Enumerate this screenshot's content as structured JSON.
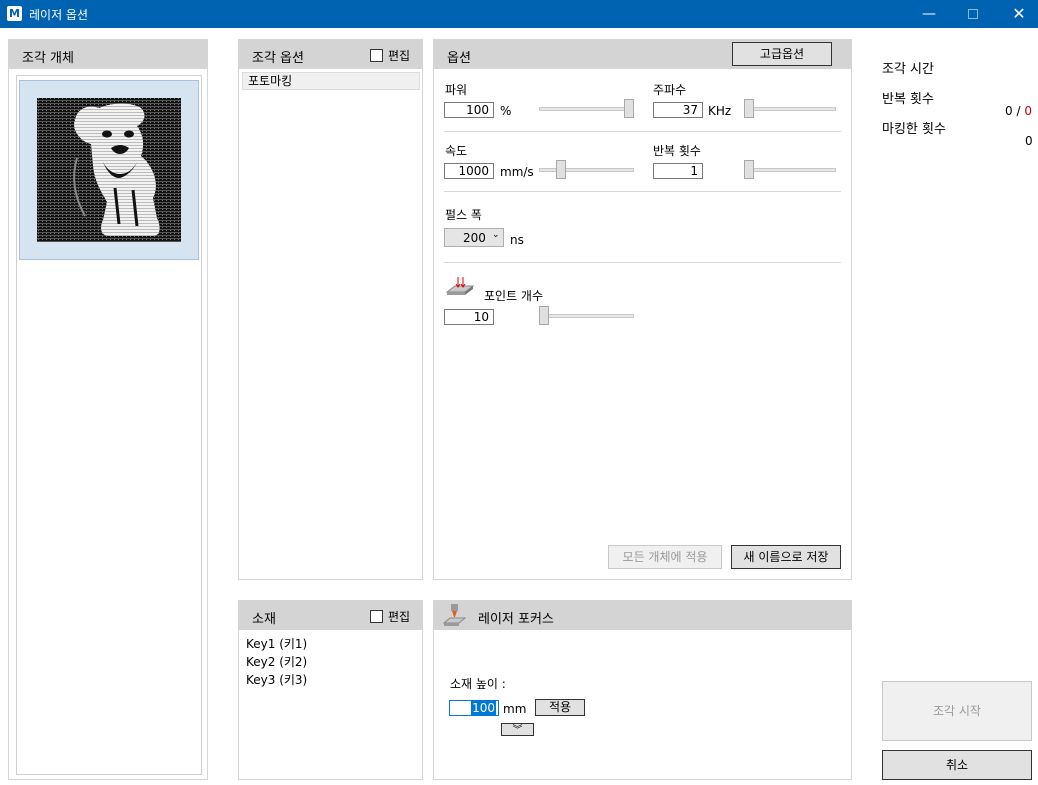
{
  "window": {
    "title": "레이저 옵션",
    "icon": "app-logo-icon",
    "minimize": "—",
    "close": "✕"
  },
  "objects_panel": {
    "title": "조각 개체"
  },
  "options_list_panel": {
    "title": "조각 옵션",
    "edit_label": "편집",
    "items": [
      "포토마킹"
    ]
  },
  "options_panel": {
    "title": "옵션",
    "advanced_button": "고급옵션",
    "power": {
      "label": "파워",
      "value": "100",
      "unit": "%",
      "slider_fraction": 1.0
    },
    "frequency": {
      "label": "주파수",
      "value": "37",
      "unit": "KHz",
      "slider_fraction": 0.0
    },
    "speed": {
      "label": "속도",
      "value": "1000",
      "unit": "mm/s",
      "slider_fraction": 0.2
    },
    "repeat": {
      "label": "반복 횟수",
      "value": "1",
      "slider_fraction": 0.0
    },
    "pulse_width": {
      "label": "펄스 폭",
      "value": "200",
      "unit": "ns"
    },
    "points": {
      "label": "포인트 개수",
      "value": "10",
      "slider_fraction": 0.0
    },
    "apply_all_button": "모든 개체에 적용",
    "save_as_button": "새 이름으로 저장"
  },
  "material_panel": {
    "title": "소재",
    "edit_label": "편집",
    "items": [
      "Key1 (키1)",
      "Key2 (키2)",
      "Key3 (키3)"
    ]
  },
  "focus_panel": {
    "title": "레이저 포커스",
    "height_label": "소재 높이 :",
    "height_value": "100",
    "height_unit": "mm",
    "apply_button": "적용",
    "expand_icon": "double-chevron-down-icon"
  },
  "stats": {
    "engrave_time_label": "조각 시간",
    "repeat_label": "반복 횟수",
    "repeat_done": "0",
    "repeat_sep": " / ",
    "repeat_total": "0",
    "marked_label": "마킹한 횟수",
    "marked_value": "0"
  },
  "start_button": "조각 시작",
  "cancel_button": "취소",
  "colors": {
    "titlebar": "#0063b1",
    "header": "#d4d4d4",
    "selection": "#d6e3f0",
    "red": "#c00000"
  }
}
